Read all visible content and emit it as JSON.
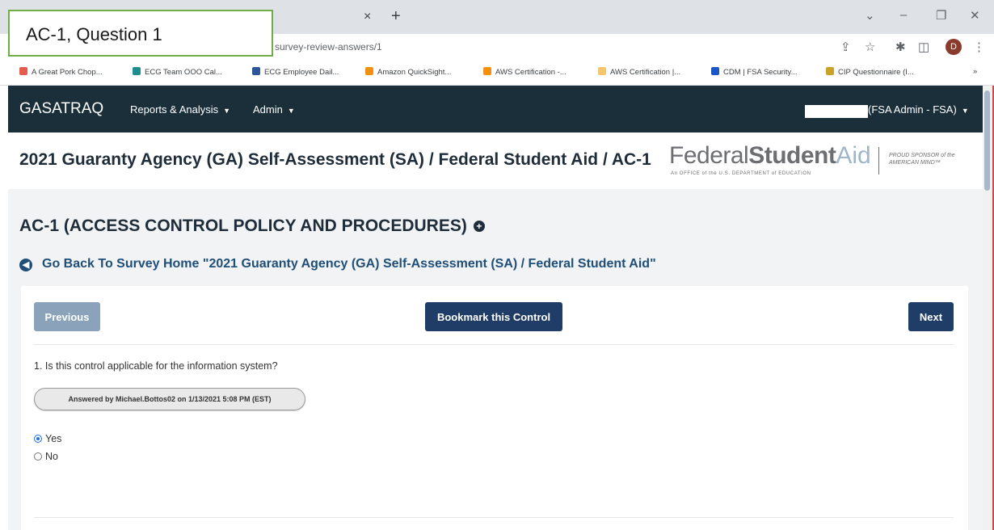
{
  "annotation": {
    "label": "AC-1, Question 1"
  },
  "browser": {
    "tab_close_glyph": "×",
    "new_tab_glyph": "+",
    "url_fragment": "survey-review-answers/1",
    "profile_initial": "D",
    "bookmarks": [
      {
        "label": "A Great Pork Chop...",
        "color": "#e55b4d"
      },
      {
        "label": "ECG Team OOO Cal...",
        "color": "#1e8e8e"
      },
      {
        "label": "ECG Employee Dail...",
        "color": "#2b579a"
      },
      {
        "label": "Amazon QuickSight...",
        "color": "#f29111"
      },
      {
        "label": "AWS Certification -...",
        "color": "#f29111"
      },
      {
        "label": "AWS Certification |...",
        "color": "#f7c56b"
      },
      {
        "label": "CDM | FSA Security...",
        "color": "#1a56c4"
      },
      {
        "label": "CIP Questionnaire (I...",
        "color": "#c9a227"
      }
    ],
    "bookmarks_more": "»"
  },
  "nav": {
    "brand": "GASATRAQ",
    "items": [
      {
        "label": "Reports & Analysis"
      },
      {
        "label": "Admin"
      }
    ],
    "user_label": "(FSA Admin - FSA)"
  },
  "header": {
    "title": "2021 Guaranty Agency (GA) Self-Assessment (SA) / Federal Student Aid / AC-1",
    "logo_federal": "Federal",
    "logo_student": "Student",
    "logo_aid": "Aid",
    "logo_tagline": "An OFFICE of the U.S. DEPARTMENT of EDUCATION",
    "logo_sponsor": "PROUD SPONSOR of the AMERICAN MIND™"
  },
  "control": {
    "heading": "AC-1 (ACCESS CONTROL POLICY AND PROCEDURES)",
    "back_link": "Go Back To Survey Home \"2021 Guaranty Agency (GA) Self-Assessment (SA) / Federal Student Aid\""
  },
  "buttons": {
    "previous": "Previous",
    "bookmark": "Bookmark this Control",
    "next": "Next"
  },
  "question": {
    "text": "1. Is this control applicable for the information system?",
    "answered_by": "Answered by Michael.Bottos02 on 1/13/2021 5:08 PM (EST)",
    "options": [
      {
        "label": "Yes",
        "selected": true
      },
      {
        "label": "No",
        "selected": false
      }
    ]
  }
}
